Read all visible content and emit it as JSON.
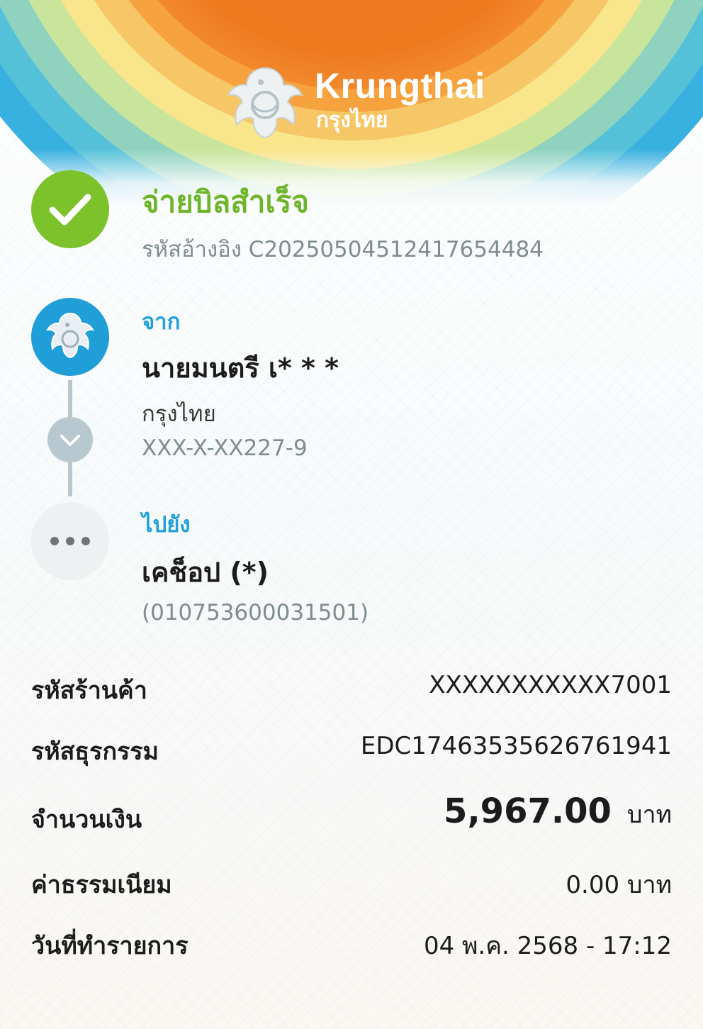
{
  "header": {
    "brand_en": "Krungthai",
    "brand_th": "กรุงไทย",
    "colors": {
      "orange": "#e9721c",
      "green": "#7cc22a",
      "blue": "#1f9ed8"
    }
  },
  "status": {
    "title": "จ่ายบิลสำเร็จ",
    "reference": "รหัสอ้างอิง C202505045124176544​84"
  },
  "from": {
    "label": "จาก",
    "name": "นายมนตรี เ* * *",
    "bank": "กรุงไทย",
    "account": "XXX-X-XX227-9"
  },
  "to": {
    "label": "ไปยัง",
    "name": "เคช็อป (*)",
    "tax_id": "(010753600031501)"
  },
  "details": {
    "merchant_label": "รหัสร้านค้า",
    "merchant_value": "XXXXXXXXXXX7001",
    "transaction_label": "รหัสธุรกรรม",
    "transaction_value": "EDC17463535626761941",
    "amount_label": "จำนวนเงิน",
    "amount_value": "5,967.00",
    "amount_unit": "บาท",
    "fee_label": "ค่าธรรมเนียม",
    "fee_value": "0.00 บาท",
    "date_label": "วันที่ทำรายการ",
    "date_value": "04 พ.ค. 2568 - 17:12"
  },
  "icons": {
    "success": "check-icon",
    "from": "krungthai-garuda-icon",
    "chevron": "chevron-down-icon",
    "to": "more-dots-icon"
  }
}
